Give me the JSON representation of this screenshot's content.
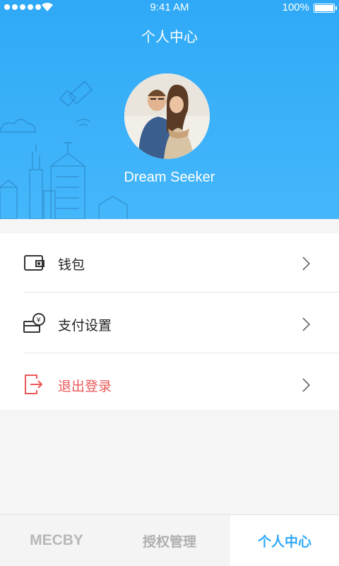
{
  "status_bar": {
    "time": "9:41 AM",
    "battery": "100%"
  },
  "header": {
    "title": "个人中心"
  },
  "profile": {
    "username": "Dream Seeker"
  },
  "menu": [
    {
      "label": "钱包",
      "icon": "wallet-icon"
    },
    {
      "label": "支付设置",
      "icon": "payment-settings-icon"
    },
    {
      "label": "退出登录",
      "icon": "logout-icon"
    }
  ],
  "tabs": [
    {
      "label": "MECBY"
    },
    {
      "label": "授权管理"
    },
    {
      "label": "个人中心",
      "active": true
    }
  ],
  "colors": {
    "accent": "#2fa9f7",
    "logout": "#ec5757"
  }
}
